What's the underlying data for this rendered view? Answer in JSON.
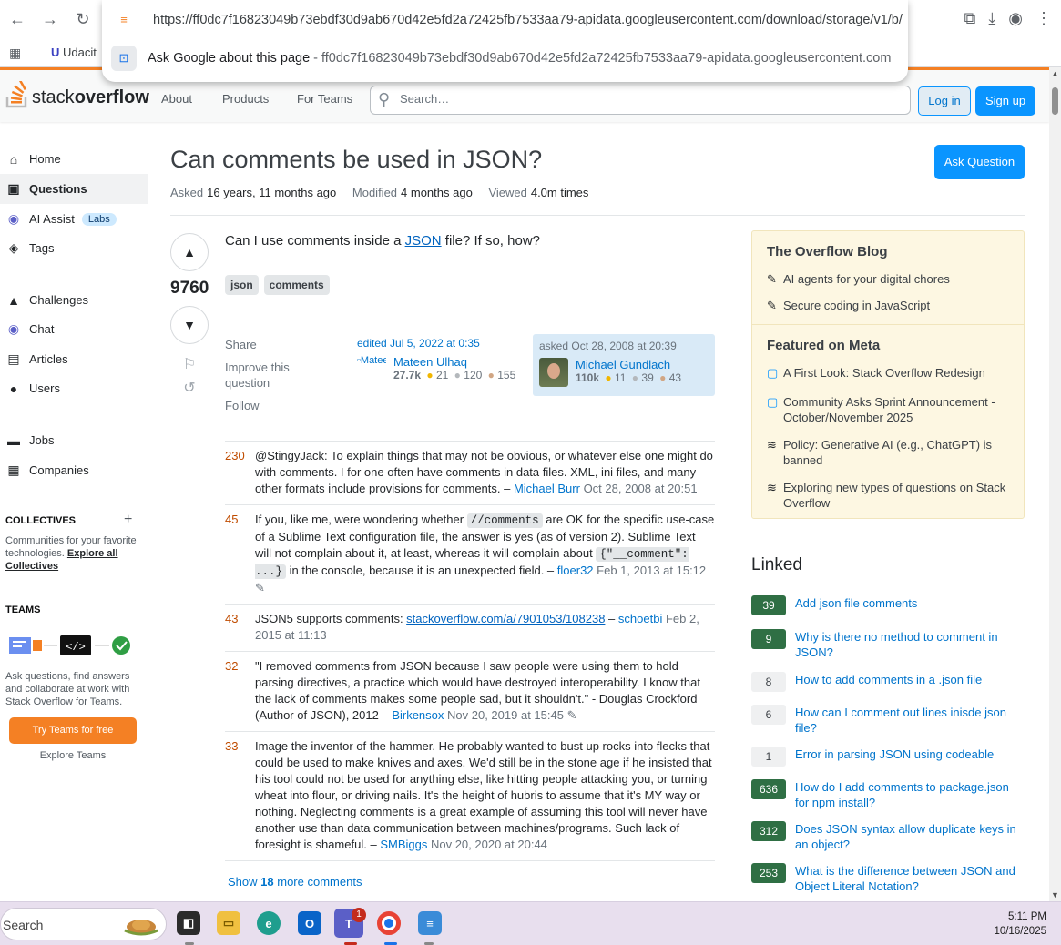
{
  "browser": {
    "omnibox": {
      "url": "https://ff0dc7f16823049b73ebdf30d9ab670d42e5fd2a72425fb7533aa79-apidata.googleusercontent.com/download/storage/v1/b/",
      "suggestion": "Ask Google about this page",
      "suggestion_sub": "- ff0dc7f16823049b73ebdf30d9ab670d42e5fd2a72425fb7533aa79-apidata.googleusercontent.com"
    },
    "bookmark": "Udacit"
  },
  "header": {
    "logo_light": "stack",
    "logo_bold": "overflow",
    "nav": [
      "About",
      "Products",
      "For Teams"
    ],
    "search_placeholder": "Search…",
    "login": "Log in",
    "signup": "Sign up"
  },
  "left_nav": {
    "items": [
      {
        "label": "Home",
        "icon": "home-icon"
      },
      {
        "label": "Questions",
        "icon": "questions-icon"
      },
      {
        "label": "AI Assist",
        "icon": "ai-assist-icon",
        "badge": "Labs"
      },
      {
        "label": "Tags",
        "icon": "tag-icon"
      },
      {
        "label": "Challenges",
        "icon": "challenges-icon"
      },
      {
        "label": "Chat",
        "icon": "chat-icon"
      },
      {
        "label": "Articles",
        "icon": "articles-icon"
      },
      {
        "label": "Users",
        "icon": "users-icon"
      },
      {
        "label": "Jobs",
        "icon": "jobs-icon"
      },
      {
        "label": "Companies",
        "icon": "companies-icon"
      }
    ],
    "collectives_title": "COLLECTIVES",
    "collectives_text": "Communities for your favorite technologies.",
    "collectives_link": "Explore all Collectives",
    "teams_title": "TEAMS",
    "teams_text": "Ask questions, find answers and collaborate at work with Stack Overflow for Teams.",
    "teams_button": "Try Teams for free",
    "teams_explore": "Explore Teams"
  },
  "question": {
    "title": "Can comments be used in JSON?",
    "asked_label": "Asked",
    "asked_value": "16 years, 11 months ago",
    "modified_label": "Modified",
    "modified_value": "4 months ago",
    "viewed_label": "Viewed",
    "viewed_value": "4.0m times",
    "ask_button": "Ask Question",
    "score": "9760",
    "body_before": "Can I use comments inside a ",
    "body_link": "JSON",
    "body_after": " file? If so, how?",
    "tags": [
      "json",
      "comments"
    ],
    "menu": [
      "Share",
      "Improve this question",
      "Follow"
    ],
    "edited": {
      "when": "edited Jul 5, 2022 at 0:35",
      "alt": "Mateen",
      "name": "Mateen Ulhaq",
      "rep": "27.7k",
      "gold": "21",
      "silver": "120",
      "bronze": "155"
    },
    "asked": {
      "when": "asked Oct 28, 2008 at 20:39",
      "name": "Michael Gundlach",
      "rep": "110k",
      "gold": "11",
      "silver": "39",
      "bronze": "43"
    }
  },
  "comments": [
    {
      "score": "230",
      "text": "@StingyJack: To explain things that may not be obvious, or whatever else one might do with comments. I for one often have comments in data files. XML, ini files, and many other formats include provisions for comments. –",
      "user": "Michael Burr",
      "date": "Oct 28, 2008 at 20:51"
    },
    {
      "score": "45",
      "t1": "If you, like me, were wondering whether ",
      "code1": "//comments",
      "t2": " are OK for the specific use-case of a Sublime Text configuration file, the answer is yes (as of version 2). Sublime Text will not complain about it, at least, whereas it will complain about ",
      "code2": "{\"__comment\": ...}",
      "t3": " in the console, because it is an unexpected field. –",
      "user": "floer32",
      "date": "Feb 1, 2013 at 15:12"
    },
    {
      "score": "43",
      "text": "JSON5 supports comments: ",
      "link": "stackoverflow.com/a/7901053/108238",
      "sep": " –",
      "user": "schoetbi",
      "date": "Feb 2, 2015 at 11:13"
    },
    {
      "score": "32",
      "text": "\"I removed comments from JSON because I saw people were using them to hold parsing directives, a practice which would have destroyed interoperability. I know that the lack of comments makes some people sad, but it shouldn't.\" - Douglas Crockford (Author of JSON), 2012 –",
      "user": "Birkensox",
      "date": "Nov 20, 2019 at 15:45"
    },
    {
      "score": "33",
      "text": "Image the inventor of the hammer. He probably wanted to bust up rocks into flecks that could be used to make knives and axes. We'd still be in the stone age if he insisted that his tool could not be used for anything else, like hitting people attacking you, or turning wheat into flour, or driving nails. It's the height of hubris to assume that it's MY way or nothing. Neglecting comments is a great example of assuming this tool will never have another use than data communication between machines/programs. Such lack of foresight is shameful. –",
      "user": "SMBiggs",
      "date": "Nov 20, 2020 at 20:44"
    }
  ],
  "show_more": {
    "prefix": "Show",
    "count": "18",
    "suffix": "more comments"
  },
  "sidebar": {
    "blog_title": "The Overflow Blog",
    "blog_items": [
      "AI agents for your digital chores",
      "Secure coding in JavaScript"
    ],
    "meta_title": "Featured on Meta",
    "meta_items": [
      "A First Look: Stack Overflow Redesign",
      "Community Asks Sprint Announcement - October/November 2025",
      "Policy: Generative AI (e.g., ChatGPT) is banned",
      "Exploring new types of questions on Stack Overflow"
    ],
    "linked_title": "Linked",
    "linked": [
      {
        "count": "39",
        "title": "Add json file comments",
        "accepted": true
      },
      {
        "count": "9",
        "title": "Why is there no method to comment in JSON?",
        "accepted": true
      },
      {
        "count": "8",
        "title": "How to add comments in a .json file",
        "accepted": false
      },
      {
        "count": "6",
        "title": "How can I comment out lines inisde json file?",
        "accepted": false
      },
      {
        "count": "1",
        "title": "Error in parsing JSON using codeable",
        "accepted": false
      },
      {
        "count": "636",
        "title": "How do I add comments to package.json for npm install?",
        "accepted": true
      },
      {
        "count": "312",
        "title": "Does JSON syntax allow duplicate keys in an object?",
        "accepted": true
      },
      {
        "count": "253",
        "title": "What is the difference between JSON and Object Literal Notation?",
        "accepted": true
      }
    ]
  },
  "taskbar": {
    "search": "Search",
    "badge": "1",
    "time": "5:11 PM",
    "date": "10/16/2025"
  }
}
